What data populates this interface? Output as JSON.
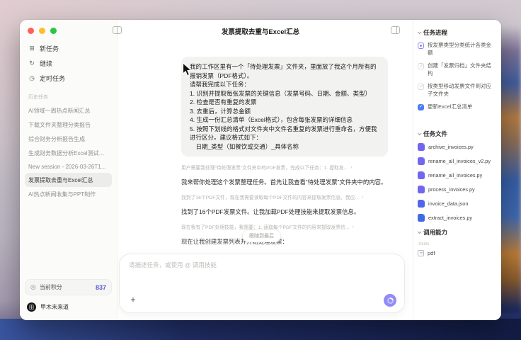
{
  "window": {
    "title": "发票提取去重与Excel汇总"
  },
  "icons": {
    "new_task": "⊞",
    "continue": "↻",
    "scheduled": "◷",
    "credits": "◎",
    "plus": "+",
    "avatar_glyph": "田"
  },
  "sidebar": {
    "nav": [
      {
        "icon": "⊞",
        "label": "新任务"
      },
      {
        "icon": "↻",
        "label": "继续"
      },
      {
        "icon": "◷",
        "label": "定时任务"
      }
    ],
    "history_label": "历史任务",
    "history": [
      {
        "label": "AI领域一周热点新闻汇总",
        "state": "normal"
      },
      {
        "label": "下载文件夹整理分类报告",
        "state": "normal"
      },
      {
        "label": "综合财务分析报告生成",
        "state": "normal"
      },
      {
        "label": "生成财务数据分析Excel测试数据",
        "state": "normal"
      },
      {
        "label": "New session - 2026-03-26T1...",
        "state": "normal"
      },
      {
        "label": "发票提取去重与Excel汇总",
        "state": "selected"
      },
      {
        "label": "AI热点新闻收集与PPT制作",
        "state": "normal"
      }
    ],
    "credits_label": "当前积分",
    "credits_value": "837",
    "user_name": "甲木未来道"
  },
  "chat": {
    "user_message": [
      {
        "text": "我的工作区里有一个「待处理发票」文件夹，里面放了我这个月所有的报销发票（PDF格式）。"
      },
      {
        "text": "请帮我完成以下任务："
      },
      {
        "text": "1. 识别并提取每张发票的关键信息（发票号码、日期、金额、类型）"
      },
      {
        "text": "2. 检查是否有重复的发票"
      },
      {
        "text": "3. 去重后，计算总金额"
      },
      {
        "text": "4. 生成一份汇总清单（Excel格式），包含每张发票的详细信息"
      },
      {
        "text": "5. 按照下划线的格式对文件夹中文件名重复的发票进行重命名，方便我进行区分。建议格式如下："
      },
      {
        "text": "　日期_类型（如餐饮或交通）_具体名称"
      }
    ],
    "messages": [
      {
        "kind": "thought",
        "text": "用户需要我处理“待处理发票”文件夹中的PDF发票，完成以下任务：1. 提取发...",
        "more": "›"
      },
      {
        "kind": "reply",
        "text": "我来帮你处理这个发票整理任务。首先让我查看“待处理发票”文件夹中的内容。"
      },
      {
        "kind": "thought",
        "text": "找到了16个PDF文件，现在我需要读取每个PDF文件的内容来提取发票信息。我应...",
        "more": "›"
      },
      {
        "kind": "reply",
        "text": "找到了16个PDF发票文件。让我加载PDF处理技能来提取发票信息。"
      },
      {
        "kind": "thought",
        "text": "现在我有了PDF处理技能，我需要：1. 读取每个PDF文件的内容来提取发票信...",
        "more": "›"
      },
      {
        "kind": "reply",
        "text": "现在让我创建发票列表并开始处理发票："
      }
    ],
    "follow_button": "跟随到最后",
    "input": {
      "placeholder": "请描述任务，或使用 @ 调用技能"
    }
  },
  "rightpanel": {
    "progress": {
      "title": "任务进程",
      "items": [
        {
          "label": "按发票类型分类统计各类金额",
          "status": "running"
        },
        {
          "label": "创建「发票归档」文件夹结构",
          "status": "pending"
        },
        {
          "label": "按类型移动发票文件到对应子文件夹",
          "status": "pending"
        },
        {
          "label": "更新Excel汇总清单",
          "status": "done"
        }
      ]
    },
    "files": {
      "title": "任务文件",
      "items": [
        {
          "name": "archive_invoices.py",
          "color": "#7166f0"
        },
        {
          "name": "rename_all_invoices_v2.py",
          "color": "#7166f0"
        },
        {
          "name": "rename_all_invoices.py",
          "color": "#7166f0"
        },
        {
          "name": "process_invoices.py",
          "color": "#7166f0"
        },
        {
          "name": "invoice_data.json",
          "color": "#4f66e8"
        },
        {
          "name": "extract_invoices.py",
          "color": "#3f6ae0"
        }
      ]
    },
    "skills": {
      "title": "调用能力",
      "group": "Skills",
      "items": [
        {
          "name": "pdf"
        }
      ]
    }
  }
}
